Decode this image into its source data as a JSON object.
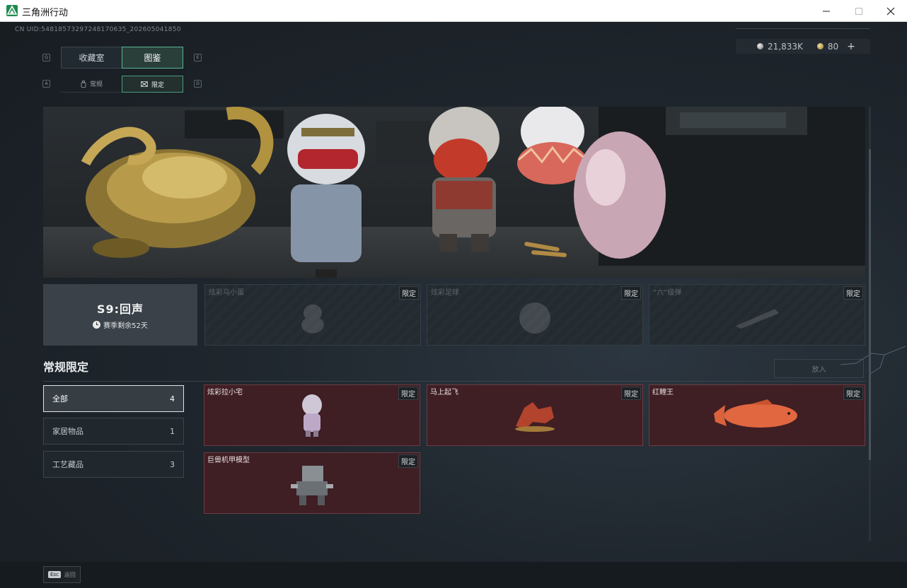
{
  "window": {
    "title": "三角洲行动"
  },
  "uid": "CN UID:5481857329724817063​5_202605041850",
  "currency": {
    "silver": "21,833K",
    "gold": "80",
    "add": "+"
  },
  "keys": {
    "prev_tab": "Q",
    "next_tab": "E",
    "prev_sub": "A",
    "next_sub": "D"
  },
  "tabs": [
    {
      "label": "收藏室"
    },
    {
      "label": "图鉴"
    }
  ],
  "subtabs": [
    {
      "label": "常规"
    },
    {
      "label": "限定"
    }
  ],
  "season": {
    "name": "S9:回声",
    "remaining": "赛季剩余52天"
  },
  "limited_cards": [
    {
      "label": "炫彩乌小蛋",
      "badge": "限定"
    },
    {
      "label": "炫彩足球",
      "badge": "限定"
    },
    {
      "label": "“六”级弹",
      "badge": "限定"
    }
  ],
  "section": {
    "title": "常规限定",
    "put_button": "放入"
  },
  "categories": [
    {
      "label": "全部",
      "count": "4"
    },
    {
      "label": "家居物品",
      "count": "1"
    },
    {
      "label": "工艺藏品",
      "count": "3"
    }
  ],
  "items": [
    {
      "name": "炫彩拉小宅",
      "badge": "限定"
    },
    {
      "name": "马上起飞",
      "badge": "限定"
    },
    {
      "name": "红鲤王",
      "badge": "限定"
    },
    {
      "name": "巨兽机甲模型",
      "badge": "限定"
    }
  ],
  "footer": {
    "esc_key": "Esc",
    "esc_label": "返回"
  }
}
